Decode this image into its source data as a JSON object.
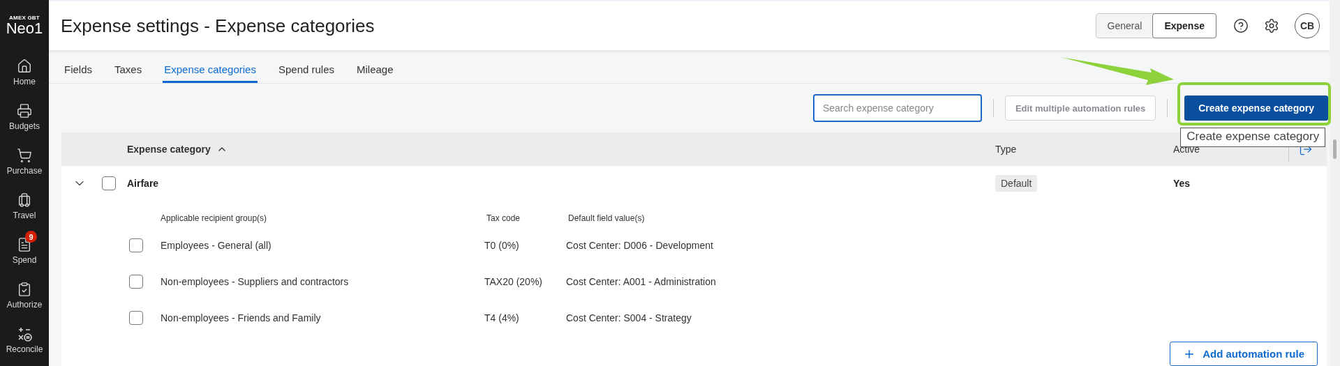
{
  "brand": {
    "company": "AMEX GBT",
    "product": "Neo1"
  },
  "nav": [
    {
      "label": "Home"
    },
    {
      "label": "Budgets"
    },
    {
      "label": "Purchase"
    },
    {
      "label": "Travel"
    },
    {
      "label": "Spend",
      "badge": "9"
    },
    {
      "label": "Authorize"
    },
    {
      "label": "Reconcile"
    }
  ],
  "header": {
    "title": "Expense settings - Expense categories",
    "toggle": [
      {
        "label": "General",
        "selected": false
      },
      {
        "label": "Expense",
        "selected": true
      }
    ],
    "avatar": "CB"
  },
  "tabs": [
    {
      "label": "Fields",
      "selected": false
    },
    {
      "label": "Taxes",
      "selected": false
    },
    {
      "label": "Expense categories",
      "selected": true
    },
    {
      "label": "Spend rules",
      "selected": false
    },
    {
      "label": "Mileage",
      "selected": false
    }
  ],
  "toolbar": {
    "search": {
      "placeholder": "Search expense category"
    },
    "edit_button": {
      "label": "Edit multiple automation rules",
      "disabled": true
    },
    "create_button": {
      "label": "Create expense category"
    },
    "tooltip": "Create expense category"
  },
  "table": {
    "columns": [
      {
        "label": "Expense category",
        "sort_ascending": true
      },
      {
        "label": "Type"
      },
      {
        "label": "Active"
      }
    ],
    "rows": [
      {
        "name": "Airfare",
        "expanded": true,
        "checked": false,
        "type": "Default",
        "active": "Yes",
        "sub_columns": [
          "Applicable recipient group(s)",
          "Tax code",
          "Default field value(s)"
        ],
        "rules": [
          {
            "group": "Employees - General (all)",
            "tax_code": "T0 (0%)",
            "default_values": "Cost Center: D006 - Development",
            "checked": false
          },
          {
            "group": "Non-employees - Suppliers and contractors",
            "tax_code": "TAX20 (20%)",
            "default_values": "Cost Center: A001 - Administration",
            "checked": false
          },
          {
            "group": "Non-employees - Friends and Family",
            "tax_code": "T4 (4%)",
            "default_values": "Cost Center: S004 - Strategy",
            "checked": false
          }
        ],
        "add_button": "Add automation rule"
      }
    ]
  }
}
